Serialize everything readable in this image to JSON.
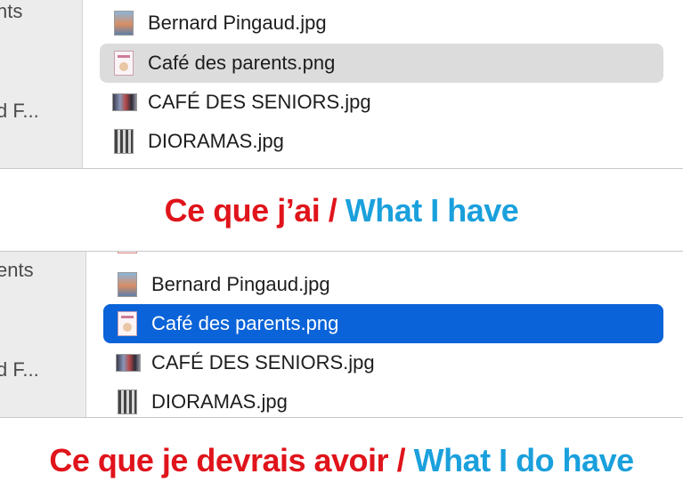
{
  "top_panel": {
    "sidebar": {
      "item1": "nts",
      "item2": "d F..."
    },
    "files": [
      {
        "name": "Bernard Pingaud.jpg",
        "icon": "portrait-thumbnail-icon",
        "selected": false
      },
      {
        "name": "Café des parents.png",
        "icon": "poster-thumbnail-icon",
        "selected": true
      },
      {
        "name": "CAFÉ DES SENIORS.jpg",
        "icon": "wide-photo-thumbnail-icon",
        "selected": false
      },
      {
        "name": "DIORAMAS.jpg",
        "icon": "diorama-thumbnail-icon",
        "selected": false
      }
    ]
  },
  "caption_top": {
    "french": "Ce que j’ai",
    "separator": "/",
    "english": "What I have"
  },
  "bottom_panel": {
    "sidebar": {
      "item1": "ents",
      "item2": "d F..."
    },
    "files": [
      {
        "name": "Bernard Pingaud.jpg",
        "icon": "portrait-thumbnail-icon",
        "selected": false
      },
      {
        "name": "Café des parents.png",
        "icon": "poster-thumbnail-icon",
        "selected": true
      },
      {
        "name": "CAFÉ DES SENIORS.jpg",
        "icon": "wide-photo-thumbnail-icon",
        "selected": false
      },
      {
        "name": "DIORAMAS.jpg",
        "icon": "diorama-thumbnail-icon",
        "selected": false
      }
    ]
  },
  "caption_bottom": {
    "french": "Ce que je devrais avoir",
    "separator": "/",
    "english": "What I do have"
  },
  "colors": {
    "selection_inactive": "#dcdcdc",
    "selection_active": "#0a63d8",
    "caption_french": "#e0141b",
    "caption_english": "#1aa0dc"
  }
}
